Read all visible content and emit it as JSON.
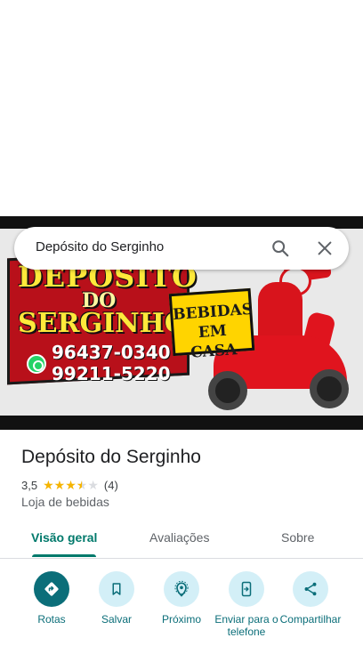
{
  "search": {
    "query": "Depósito do Serginho"
  },
  "banner": {
    "logo_line1": "DEPÓSITO",
    "logo_line2": "DO",
    "logo_line3": "SERGINHO",
    "phone1": "96437-0340",
    "phone2": "99211-5220",
    "badge_line1": "BEBIDAS",
    "badge_line2": "EM CASA"
  },
  "place": {
    "title": "Depósito do Serginho",
    "rating": "3,5",
    "rating_value": 3.5,
    "review_count": "(4)",
    "category": "Loja de bebidas"
  },
  "tabs": [
    {
      "label": "Visão geral",
      "active": true
    },
    {
      "label": "Avaliações",
      "active": false
    },
    {
      "label": "Sobre",
      "active": false
    }
  ],
  "actions": [
    {
      "label": "Rotas",
      "icon": "directions-icon"
    },
    {
      "label": "Salvar",
      "icon": "bookmark-icon"
    },
    {
      "label": "Próximo",
      "icon": "nearby-icon"
    },
    {
      "label": "Enviar para o telefone",
      "icon": "send-to-phone-icon"
    },
    {
      "label": "Compartilhar",
      "icon": "share-icon"
    }
  ],
  "colors": {
    "accent": "#0b6e79",
    "tab_active": "#00796b",
    "star": "#f5b400",
    "action_bg": "#d3eff7"
  }
}
